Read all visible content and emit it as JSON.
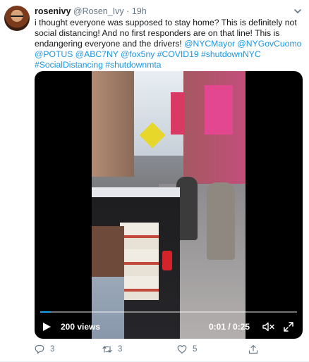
{
  "user": {
    "display_name": "rosenivy",
    "handle": "@Rosen_Ivy",
    "separator": "·",
    "time": "19h"
  },
  "tweet": {
    "text_plain": "i thought everyone was supposed to stay home? This is definitely not social distancing! And no first responders are on that line! This is endangering everyone and the drivers! ",
    "mentions_line1": "@NYCMayor @NYGovCuomo",
    "mentions_line2": "@POTUS @ABC7NY @fox5ny #COVID19 #shutdownNYC",
    "mentions_line3": "#SocialDistancing #shutdownmta"
  },
  "video": {
    "views_label": "200 views",
    "timecode": "0:01 / 0:25",
    "progress_fraction": 0.04
  },
  "actions": {
    "reply_count": "3",
    "retweet_count": "3",
    "like_count": "5"
  },
  "icons": {
    "more": "chevron-down-icon",
    "play": "play-icon",
    "volume": "volume-mute-icon",
    "fullscreen": "fullscreen-icon",
    "reply": "reply-icon",
    "retweet": "retweet-icon",
    "like": "heart-icon",
    "share": "share-icon"
  },
  "colors": {
    "link": "#1b95e0",
    "progress": "#1da1f2",
    "muted": "#657786"
  }
}
